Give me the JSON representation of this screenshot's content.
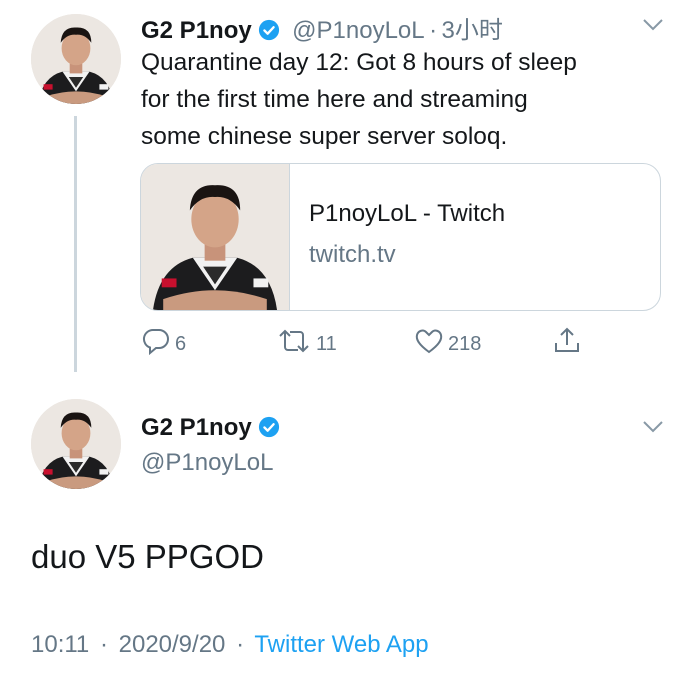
{
  "tweet1": {
    "display_name": "G2 P1noy",
    "handle": "@P1noyLoL",
    "separator": "·",
    "time": "3小时",
    "text_lines": [
      "Quarantine day 12: Got 8 hours of sleep",
      "for the first time here  and streaming",
      "some chinese super server  soloq."
    ],
    "card": {
      "title": "P1noyLoL - Twitch",
      "domain": "twitch.tv"
    },
    "actions": {
      "replies": "6",
      "retweets": "11",
      "likes": "218"
    },
    "icons": [
      "verified-badge-icon",
      "chevron-down-icon",
      "reply-icon",
      "retweet-icon",
      "like-icon",
      "share-icon"
    ]
  },
  "tweet2": {
    "display_name": "G2 P1noy",
    "handle": "@P1noyLoL",
    "text": "duo V5 PPGOD",
    "time": "10:11",
    "separator": "·",
    "date": "2020/9/20",
    "source": "Twitter Web App"
  },
  "colors": {
    "accent": "#1da1f2",
    "secondary_text": "#657786",
    "border": "#ccd6dd"
  }
}
